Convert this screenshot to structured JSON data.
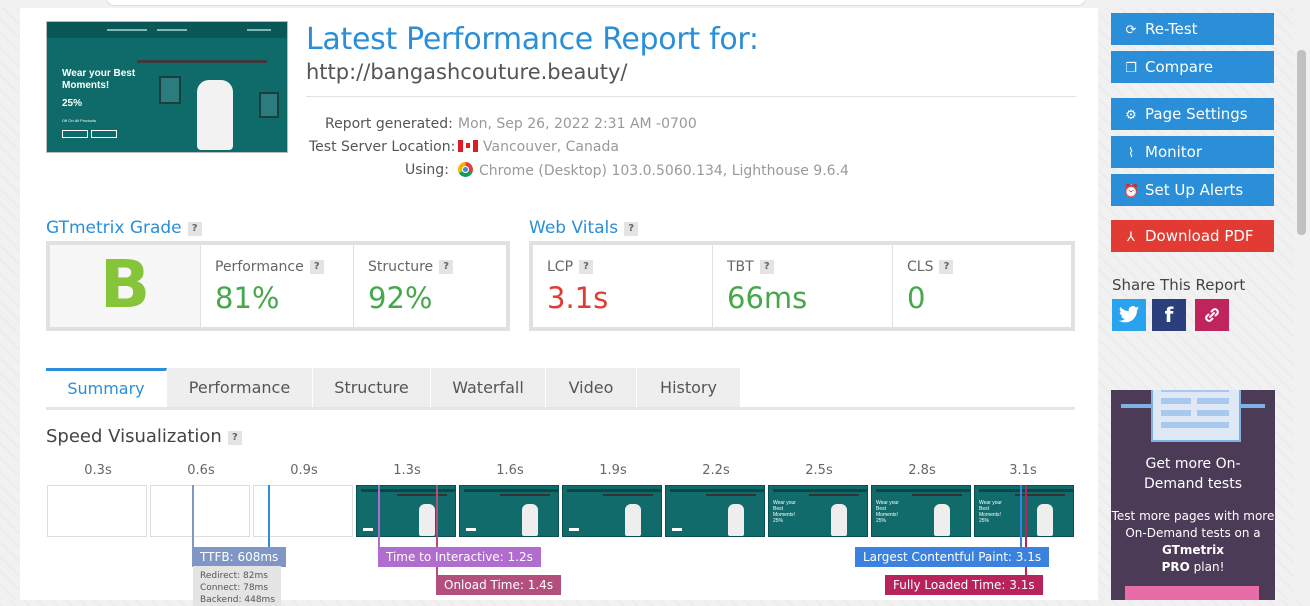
{
  "report": {
    "title": "Latest Performance Report for:",
    "url": "http://bangashcouture.beauty/",
    "thumbnail": {
      "headline": "Wear your Best Moments!",
      "discount": "25%",
      "subline": "Off On All Products"
    },
    "meta": [
      {
        "label": "Report generated:",
        "value": "Mon, Sep 26, 2022 2:31 AM -0700",
        "icon": ""
      },
      {
        "label": "Test Server Location:",
        "value": "Vancouver, Canada",
        "icon": "canada-flag-icon"
      },
      {
        "label": "Using:",
        "value": "Chrome (Desktop) 103.0.5060.134, Lighthouse 9.6.4",
        "icon": "chrome-icon"
      }
    ]
  },
  "gtmetrix": {
    "title": "GTmetrix Grade",
    "help": "?",
    "grade": "B",
    "performance": {
      "label": "Performance",
      "value": "81%"
    },
    "structure": {
      "label": "Structure",
      "value": "92%"
    }
  },
  "web_vitals": {
    "title": "Web Vitals",
    "help": "?",
    "lcp": {
      "label": "LCP",
      "value": "3.1s",
      "color": "#e13b33"
    },
    "tbt": {
      "label": "TBT",
      "value": "66ms",
      "color": "#47a84b"
    },
    "cls": {
      "label": "CLS",
      "value": "0",
      "color": "#47a84b"
    }
  },
  "tabs": [
    "Summary",
    "Performance",
    "Structure",
    "Waterfall",
    "Video",
    "History"
  ],
  "active_tab": "Summary",
  "speed_visualization": {
    "title": "Speed Visualization",
    "help": "?",
    "ticks": [
      "0.3s",
      "0.6s",
      "0.9s",
      "1.3s",
      "1.6s",
      "1.9s",
      "2.2s",
      "2.5s",
      "2.8s",
      "3.1s"
    ],
    "frame_text": "Wear your Best Moments! 25%",
    "markers": {
      "ttfb": "TTFB: 608ms",
      "tti": "Time to Interactive: 1.2s",
      "onload": "Onload Time: 1.4s",
      "lcp": "Largest Contentful Paint: 3.1s",
      "fully_loaded": "Fully Loaded Time: 3.1s"
    },
    "ttfb_detail": [
      "Redirect: 82ms",
      "Connect: 78ms",
      "Backend: 448ms"
    ]
  },
  "sidebar": {
    "buttons": [
      {
        "label": "Re-Test",
        "icon": "refresh-icon"
      },
      {
        "label": "Compare",
        "icon": "compare-icon"
      },
      {
        "label": "Page Settings",
        "icon": "gear-icon"
      },
      {
        "label": "Monitor",
        "icon": "pulse-icon"
      },
      {
        "label": "Set Up Alerts",
        "icon": "alarm-clock-icon"
      },
      {
        "label": "Download PDF",
        "icon": "pdf-icon"
      }
    ],
    "share_title": "Share This Report",
    "share": [
      "twitter-icon",
      "facebook-icon",
      "link-icon"
    ]
  },
  "promo": {
    "headline": "Get more On-Demand tests",
    "body_1": "Test more pages with more On-Demand tests on a ",
    "brand": "GTmetrix",
    "body_2": "PRO",
    "body_3": "plan!"
  },
  "colors": {
    "accent": "#2a8fd8",
    "grade": "#86c53a",
    "good": "#47a84b",
    "bad": "#e13b33",
    "ttfb_marker": "#8096c4",
    "tti_marker": "#b06ccf",
    "onload_marker": "#b24f7c",
    "lcp_marker": "#3b82e0",
    "fully_loaded_marker": "#b8225d",
    "promo_bg": "#4c3b57"
  }
}
